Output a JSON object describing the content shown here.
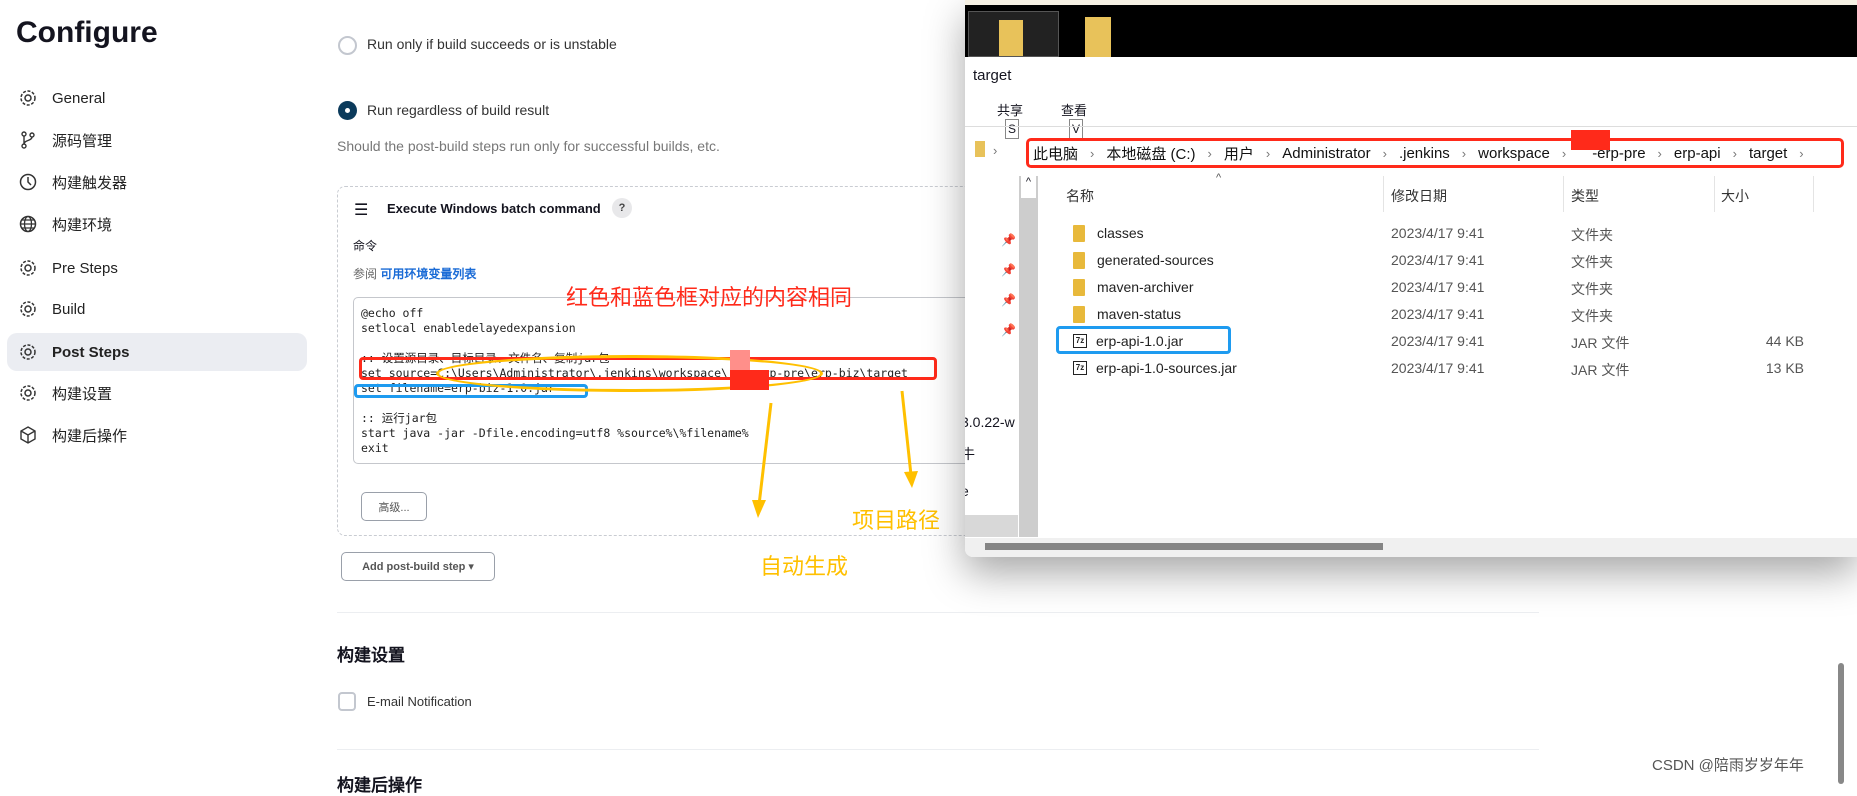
{
  "page": {
    "title": "Configure"
  },
  "sidebar": {
    "items": [
      {
        "label": "General",
        "icon": "gear-icon"
      },
      {
        "label": "源码管理",
        "icon": "branch-icon"
      },
      {
        "label": "构建触发器",
        "icon": "clock-icon"
      },
      {
        "label": "构建环境",
        "icon": "globe-icon"
      },
      {
        "label": "Pre Steps",
        "icon": "gear-icon"
      },
      {
        "label": "Build",
        "icon": "gear-icon"
      },
      {
        "label": "Post Steps",
        "icon": "gear-icon",
        "active": true
      },
      {
        "label": "构建设置",
        "icon": "gear-icon"
      },
      {
        "label": "构建后操作",
        "icon": "package-icon"
      }
    ]
  },
  "post_steps": {
    "radio1": "Run only if build succeeds or is unstable",
    "radio2": "Run regardless of build result",
    "selected": "radio2",
    "help": "Should the post-build steps run only for successful builds, etc.",
    "step_title": "Execute Windows batch command",
    "help_icon": "?",
    "command_label": "命令",
    "see_prefix": "参阅",
    "env_link": "可用环境变量列表",
    "code": [
      "@echo off",
      "setlocal enabledelayedexpansion",
      "",
      ":: 设置源目录、目标目录、文件名、复制jar包",
      "set source=C:\\Users\\Administrator\\.jenkins\\workspace\\    erp-pre\\erp-biz\\target",
      "set filename=erp-biz-1.0.jar",
      "",
      ":: 运行jar包",
      "start java -jar -Dfile.encoding=utf8 %source%\\%filename%",
      "exit"
    ],
    "advanced": "高级...",
    "add_step": "Add post-build step ▾"
  },
  "build_settings": {
    "heading": "构建设置",
    "email": "E-mail Notification"
  },
  "post_build": {
    "heading": "构建后操作"
  },
  "annotations": {
    "red_note": "红色和蓝色框对应的内容相同",
    "path_note": "项目路径",
    "auto_note": "自动生成",
    "red": "#ff2a1a",
    "blue": "#1e9bf0",
    "yellow": "#ffc000"
  },
  "explorer": {
    "title": "target",
    "ribbon": [
      {
        "label": "共享",
        "key": "S"
      },
      {
        "label": "查看",
        "key": "V"
      }
    ],
    "breadcrumb": [
      "此电脑",
      "本地磁盘 (C:)",
      "用户",
      "Administrator",
      ".jenkins",
      "workspace",
      "-erp-pre",
      "erp-api",
      "target"
    ],
    "columns": [
      "名称",
      "修改日期",
      "类型",
      "大小"
    ],
    "files": [
      {
        "name": "classes",
        "date": "2023/4/17 9:41",
        "type": "文件夹",
        "size": "",
        "kind": "folder"
      },
      {
        "name": "generated-sources",
        "date": "2023/4/17 9:41",
        "type": "文件夹",
        "size": "",
        "kind": "folder"
      },
      {
        "name": "maven-archiver",
        "date": "2023/4/17 9:41",
        "type": "文件夹",
        "size": "",
        "kind": "folder"
      },
      {
        "name": "maven-status",
        "date": "2023/4/17 9:41",
        "type": "文件夹",
        "size": "",
        "kind": "folder"
      },
      {
        "name": "erp-api-1.0.jar",
        "date": "2023/4/17 9:41",
        "type": "JAR 文件",
        "size": "44 KB",
        "kind": "jar"
      },
      {
        "name": "erp-api-1.0-sources.jar",
        "date": "2023/4/17 9:41",
        "type": "JAR 文件",
        "size": "13 KB",
        "kind": "jar"
      }
    ],
    "nav_fragments": [
      "3.0.22-w",
      "牛",
      "e"
    ]
  },
  "watermark": "CSDN @陪雨岁岁年年"
}
